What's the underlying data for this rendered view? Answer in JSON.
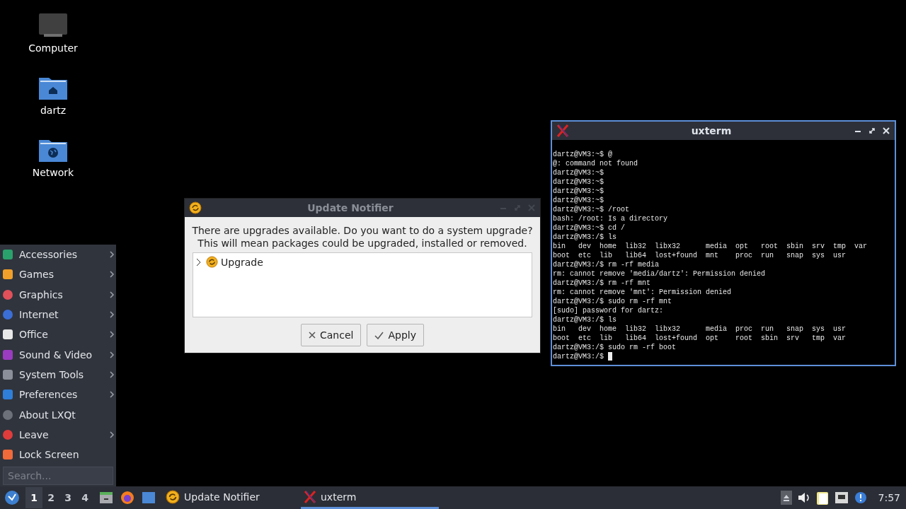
{
  "desktop_icons": [
    {
      "label": "Computer",
      "kind": "computer"
    },
    {
      "label": "dartz",
      "kind": "home"
    },
    {
      "label": "Network",
      "kind": "network"
    }
  ],
  "update_window": {
    "title": "Update Notifier",
    "active": false,
    "message": [
      "There are upgrades available. Do you want to do a system upgrade?",
      "This will mean packages could be upgraded, installed or removed."
    ],
    "tree": [
      {
        "label": "Upgrade",
        "expanded": false
      }
    ],
    "buttons": [
      {
        "label": "Cancel",
        "kind": "cancel"
      },
      {
        "label": "Apply",
        "kind": "apply"
      }
    ]
  },
  "terminal": {
    "title": "uxterm",
    "active": true,
    "lines": [
      "dartz@VM3:~$ @",
      "@: command not found",
      "dartz@VM3:~$",
      "dartz@VM3:~$",
      "dartz@VM3:~$",
      "dartz@VM3:~$",
      "dartz@VM3:~$ /root",
      "bash: /root: Is a directory",
      "dartz@VM3:~$ cd /",
      "dartz@VM3:/$ ls",
      "bin   dev  home  lib32  libx32      media  opt   root  sbin  srv  tmp  var",
      "boot  etc  lib   lib64  lost+found  mnt    proc  run   snap  sys  usr",
      "dartz@VM3:/$ rm -rf media",
      "rm: cannot remove 'media/dartz': Permission denied",
      "dartz@VM3:/$ rm -rf mnt",
      "rm: cannot remove 'mnt': Permission denied",
      "dartz@VM3:/$ sudo rm -rf mnt",
      "[sudo] password for dartz:",
      "dartz@VM3:/$ ls",
      "bin   dev  home  lib32  libx32      media  proc  run   snap  sys  usr",
      "boot  etc  lib   lib64  lost+found  opt    root  sbin  srv   tmp  var",
      "dartz@VM3:/$ sudo rm -rf boot",
      "dartz@VM3:/$"
    ]
  },
  "start_menu": {
    "items": [
      {
        "label": "Accessories",
        "kind": "accessories",
        "submenu": true
      },
      {
        "label": "Games",
        "kind": "games",
        "submenu": true
      },
      {
        "label": "Graphics",
        "kind": "graphics",
        "submenu": true
      },
      {
        "label": "Internet",
        "kind": "internet",
        "submenu": true
      },
      {
        "label": "Office",
        "kind": "office",
        "submenu": true
      },
      {
        "label": "Sound & Video",
        "kind": "media",
        "submenu": true
      },
      {
        "label": "System Tools",
        "kind": "system",
        "submenu": true
      },
      {
        "label": "Preferences",
        "kind": "preferences",
        "submenu": true
      },
      {
        "label": "About LXQt",
        "kind": "about",
        "submenu": false
      },
      {
        "label": "Leave",
        "kind": "leave",
        "submenu": true
      },
      {
        "label": "Lock Screen",
        "kind": "lock",
        "submenu": false
      }
    ],
    "search": {
      "placeholder": "Search..."
    }
  },
  "taskbar": {
    "desktops": [
      {
        "label": "1",
        "selected": true
      },
      {
        "label": "2",
        "selected": false
      },
      {
        "label": "3",
        "selected": false
      },
      {
        "label": "4",
        "selected": false
      }
    ],
    "launchers": [
      {
        "kind": "files"
      },
      {
        "kind": "browser"
      },
      {
        "kind": "window"
      }
    ],
    "tasks": [
      {
        "label": "Update Notifier",
        "kind": "update",
        "selected": false
      },
      {
        "label": "uxterm",
        "kind": "terminal",
        "selected": true
      }
    ],
    "tray": [
      {
        "kind": "eject"
      },
      {
        "kind": "volume"
      },
      {
        "kind": "clipboard"
      },
      {
        "kind": "network"
      },
      {
        "kind": "notify"
      }
    ],
    "clock": "7:57"
  }
}
